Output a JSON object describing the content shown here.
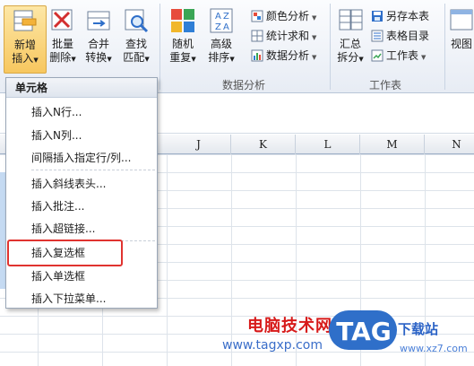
{
  "toolbar": {
    "insert_new": [
      "新增",
      "插入"
    ],
    "batch_delete": [
      "批量",
      "删除"
    ],
    "merge_convert": [
      "合并",
      "转换"
    ],
    "find_match": [
      "查找",
      "匹配"
    ],
    "random_repeat": [
      "随机",
      "重复"
    ],
    "advanced_sort": [
      "高级",
      "排序"
    ],
    "color_analysis": "颜色分析",
    "stat_sum": "统计求和",
    "data_analysis_btn": "数据分析",
    "data_analysis_group": "数据分析",
    "summary_split": [
      "汇总",
      "拆分"
    ],
    "save_sheet": "另存本表",
    "sheet_directory": "表格目录",
    "worksheet_btn": "工作表",
    "worksheet_group": "工作表",
    "view": "视图"
  },
  "menu": {
    "header": "单元格",
    "items": [
      "插入N行...",
      "插入N列...",
      "间隔插入指定行/列...",
      "插入斜线表头...",
      "插入批注...",
      "插入超链接...",
      "插入复选框",
      "插入单选框",
      "插入下拉菜单..."
    ],
    "highlighted_index": 6
  },
  "columns": [
    "J",
    "K",
    "L",
    "M",
    "N"
  ],
  "watermark": {
    "text": "电脑技术网",
    "url": "www.tagxp.com",
    "logo": "TAG",
    "site": "下载站",
    "site_url": "www.xz7.com"
  },
  "colors": {
    "accent_highlight": "#e0332f",
    "selected_button": "#f7c75f"
  }
}
